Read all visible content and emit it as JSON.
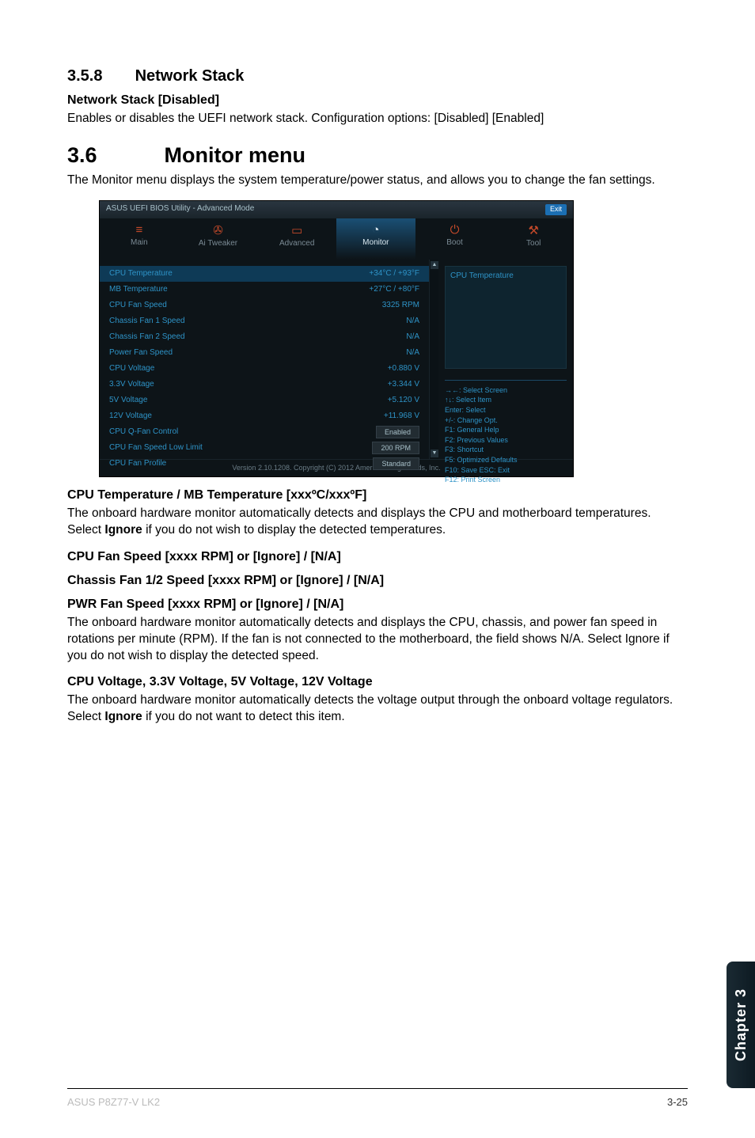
{
  "s358": {
    "num": "3.5.8",
    "title": "Network Stack"
  },
  "ns": {
    "heading": "Network Stack [Disabled]",
    "body": "Enables or disables the UEFI network stack. Configuration options: [Disabled] [Enabled]"
  },
  "s36": {
    "num": "3.6",
    "title": "Monitor menu"
  },
  "s36_intro": "The Monitor menu displays the system temperature/power status, and allows you to change the fan settings.",
  "bios": {
    "titlebar": "ASUS UEFI BIOS Utility - Advanced Mode",
    "exit": "Exit",
    "tabs": {
      "main": "Main",
      "aitweaker": "Ai Tweaker",
      "advanced": "Advanced",
      "monitor": "Monitor",
      "boot": "Boot",
      "tool": "Tool"
    },
    "rows": {
      "cpu_temp": {
        "label": "CPU Temperature",
        "value": "+34°C / +93°F"
      },
      "mb_temp": {
        "label": "MB Temperature",
        "value": "+27°C / +80°F"
      },
      "cpu_fan": {
        "label": "CPU Fan Speed",
        "value": "3325 RPM"
      },
      "cha1": {
        "label": "Chassis Fan 1 Speed",
        "value": "N/A"
      },
      "cha2": {
        "label": "Chassis Fan 2 Speed",
        "value": "N/A"
      },
      "pwr_fan": {
        "label": "Power Fan Speed",
        "value": "N/A"
      },
      "cpu_v": {
        "label": "CPU Voltage",
        "value": "+0.880 V"
      },
      "v33": {
        "label": "3.3V Voltage",
        "value": "+3.344 V"
      },
      "v5": {
        "label": "5V Voltage",
        "value": "+5.120 V"
      },
      "v12": {
        "label": "12V Voltage",
        "value": "+11.968 V"
      },
      "qfan": {
        "label": "CPU Q-Fan Control",
        "value": "Enabled"
      },
      "low_limit": {
        "label": "CPU Fan Speed Low Limit",
        "value": "200 RPM"
      },
      "profile": {
        "label": "CPU Fan Profile",
        "value": "Standard"
      }
    },
    "right_top": "CPU Temperature",
    "help": [
      "→←: Select Screen",
      "↑↓: Select Item",
      "Enter: Select",
      "+/-: Change Opt.",
      "F1: General Help",
      "F2: Previous Values",
      "F3: Shortcut",
      "F5: Optimized Defaults",
      "F10: Save  ESC: Exit",
      "F12: Print Screen"
    ],
    "footer": "Version 2.10.1208. Copyright (C) 2012 American Megatrends, Inc."
  },
  "cpu_mb_temp": {
    "heading": "CPU Temperature / MB Temperature [xxxºC/xxxºF]",
    "body_a": "The onboard hardware monitor automatically detects and displays the CPU and motherboard temperatures. Select ",
    "body_b": "Ignore",
    "body_c": " if you do not wish to display the detected temperatures."
  },
  "cpu_fan_h": "CPU Fan Speed [xxxx RPM] or [Ignore] / [N/A]",
  "chassis_fan_h": "Chassis Fan 1/2 Speed [xxxx RPM] or [Ignore] / [N/A]",
  "pwr_fan": {
    "heading": "PWR Fan Speed [xxxx RPM] or [Ignore] / [N/A]",
    "body": "The onboard hardware monitor automatically detects and displays the CPU, chassis, and power fan speed in rotations per minute (RPM). If the fan is not connected to the motherboard, the field shows N/A. Select Ignore if you do not wish to display the detected speed."
  },
  "voltages": {
    "heading": "CPU Voltage, 3.3V Voltage, 5V Voltage, 12V Voltage",
    "body_a": "The onboard hardware monitor automatically detects the voltage output through the onboard voltage regulators. Select ",
    "body_b": "Ignore",
    "body_c": " if you do not want to detect this item."
  },
  "side_tab": "Chapter 3",
  "footer": {
    "left": "ASUS P8Z77-V LK2",
    "right": "3-25"
  }
}
